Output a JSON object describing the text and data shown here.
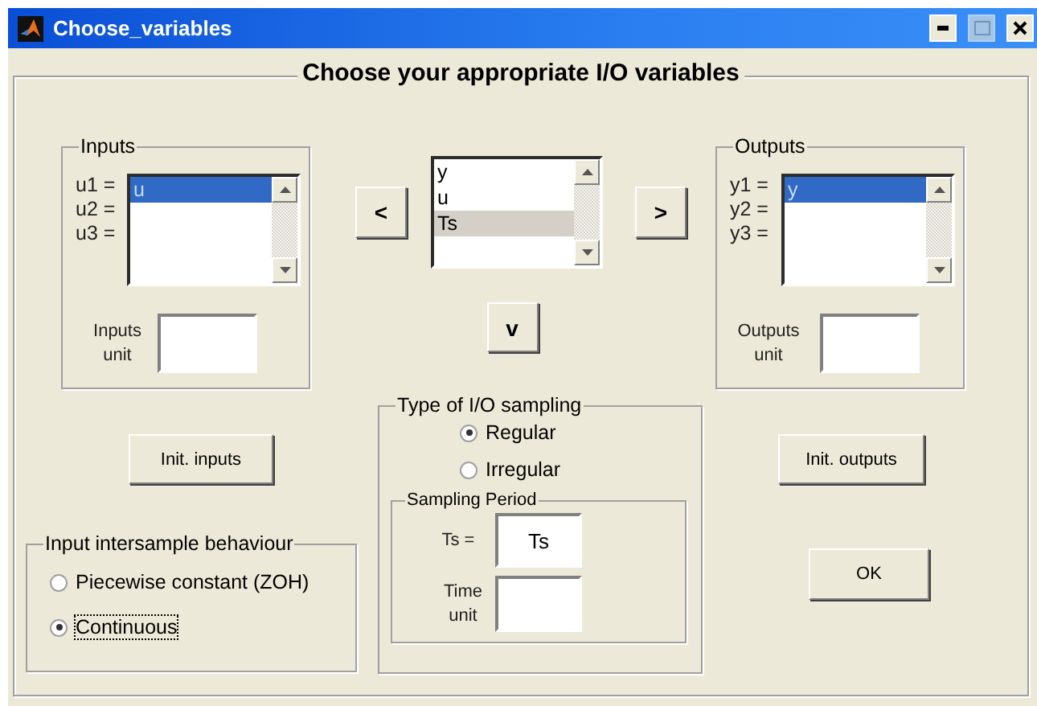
{
  "window": {
    "title": "Choose_variables"
  },
  "frame_title": "Choose your appropriate I/O variables",
  "inputs": {
    "title": "Inputs",
    "labels": [
      "u1 =",
      "u2 =",
      "u3 ="
    ],
    "focused": true,
    "items": [
      {
        "text": "u",
        "selected": true
      }
    ],
    "unit_label": "Inputs unit"
  },
  "variables": {
    "focused": false,
    "items": [
      {
        "text": "y",
        "selected": false
      },
      {
        "text": "u",
        "selected": false
      },
      {
        "text": "Ts",
        "selected": true
      }
    ]
  },
  "outputs": {
    "title": "Outputs",
    "labels": [
      "y1 =",
      "y2 =",
      "y3 ="
    ],
    "focused": true,
    "items": [
      {
        "text": "y",
        "selected": true
      }
    ],
    "unit_label": "Outputs unit"
  },
  "move_buttons": {
    "left": "<",
    "right": ">",
    "down": "v"
  },
  "init_inputs": "Init. inputs",
  "init_outputs": "Init. outputs",
  "sampling": {
    "title": "Type of I/O sampling",
    "options": [
      {
        "label": "Regular",
        "selected": true
      },
      {
        "label": "Irregular",
        "selected": false
      }
    ],
    "period": {
      "title": "Sampling Period",
      "ts_label": "Ts =",
      "ts_value": "Ts",
      "time_unit_label": "Time unit"
    }
  },
  "intersample": {
    "title": "Input intersample behaviour",
    "options": [
      {
        "label": "Piecewise constant (ZOH)",
        "selected": false,
        "focused": false
      },
      {
        "label": "Continuous",
        "selected": true,
        "focused": true
      }
    ]
  },
  "ok": "OK"
}
